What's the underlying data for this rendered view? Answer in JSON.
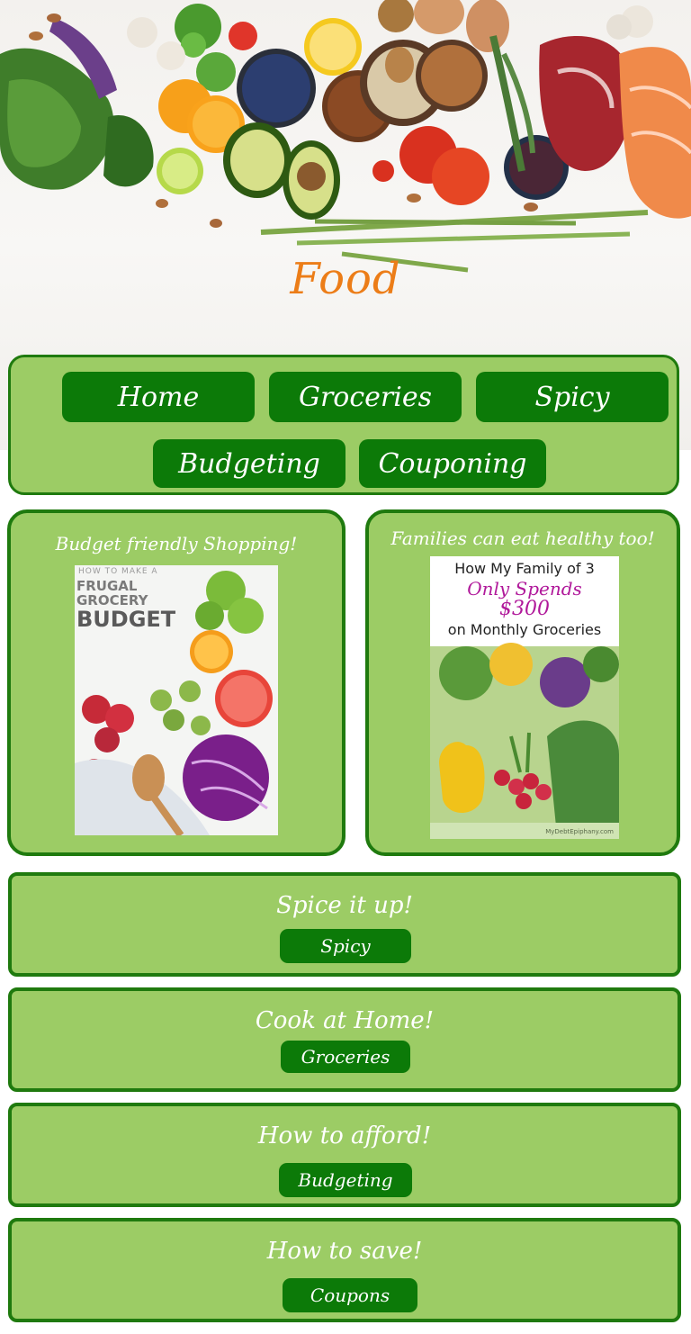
{
  "hero": {
    "title": "Food",
    "image_alt": "fresh-vegetables-fruits-meat-fish"
  },
  "nav": {
    "items": [
      {
        "label": "Home"
      },
      {
        "label": "Groceries"
      },
      {
        "label": "Spicy"
      },
      {
        "label": "Budgeting"
      },
      {
        "label": "Couponing"
      }
    ]
  },
  "cards": [
    {
      "caption": "Budget friendly Shopping!",
      "image": {
        "line1": "HOW TO MAKE A",
        "line2": "FRUGAL",
        "line3": "GROCERY",
        "line4": "BUDGET"
      }
    },
    {
      "caption": "Families can eat healthy too!",
      "image": {
        "line1": "How My Family of 3",
        "line2": "Only Spends",
        "line3": "$300",
        "line4": "on Monthly Groceries",
        "watermark": "MyDebtEpiphany.com"
      }
    }
  ],
  "sections": [
    {
      "title": "Spice it up!",
      "button": "Spicy"
    },
    {
      "title": "Cook at Home!",
      "button": "Groceries"
    },
    {
      "title": "How to afford!",
      "button": "Budgeting"
    },
    {
      "title": "How to save!",
      "button": "Coupons"
    }
  ],
  "colors": {
    "panel": "#9ccc65",
    "panel_border": "#1f7a0e",
    "button": "#0c7a08",
    "title_orange": "#ec7d18"
  }
}
